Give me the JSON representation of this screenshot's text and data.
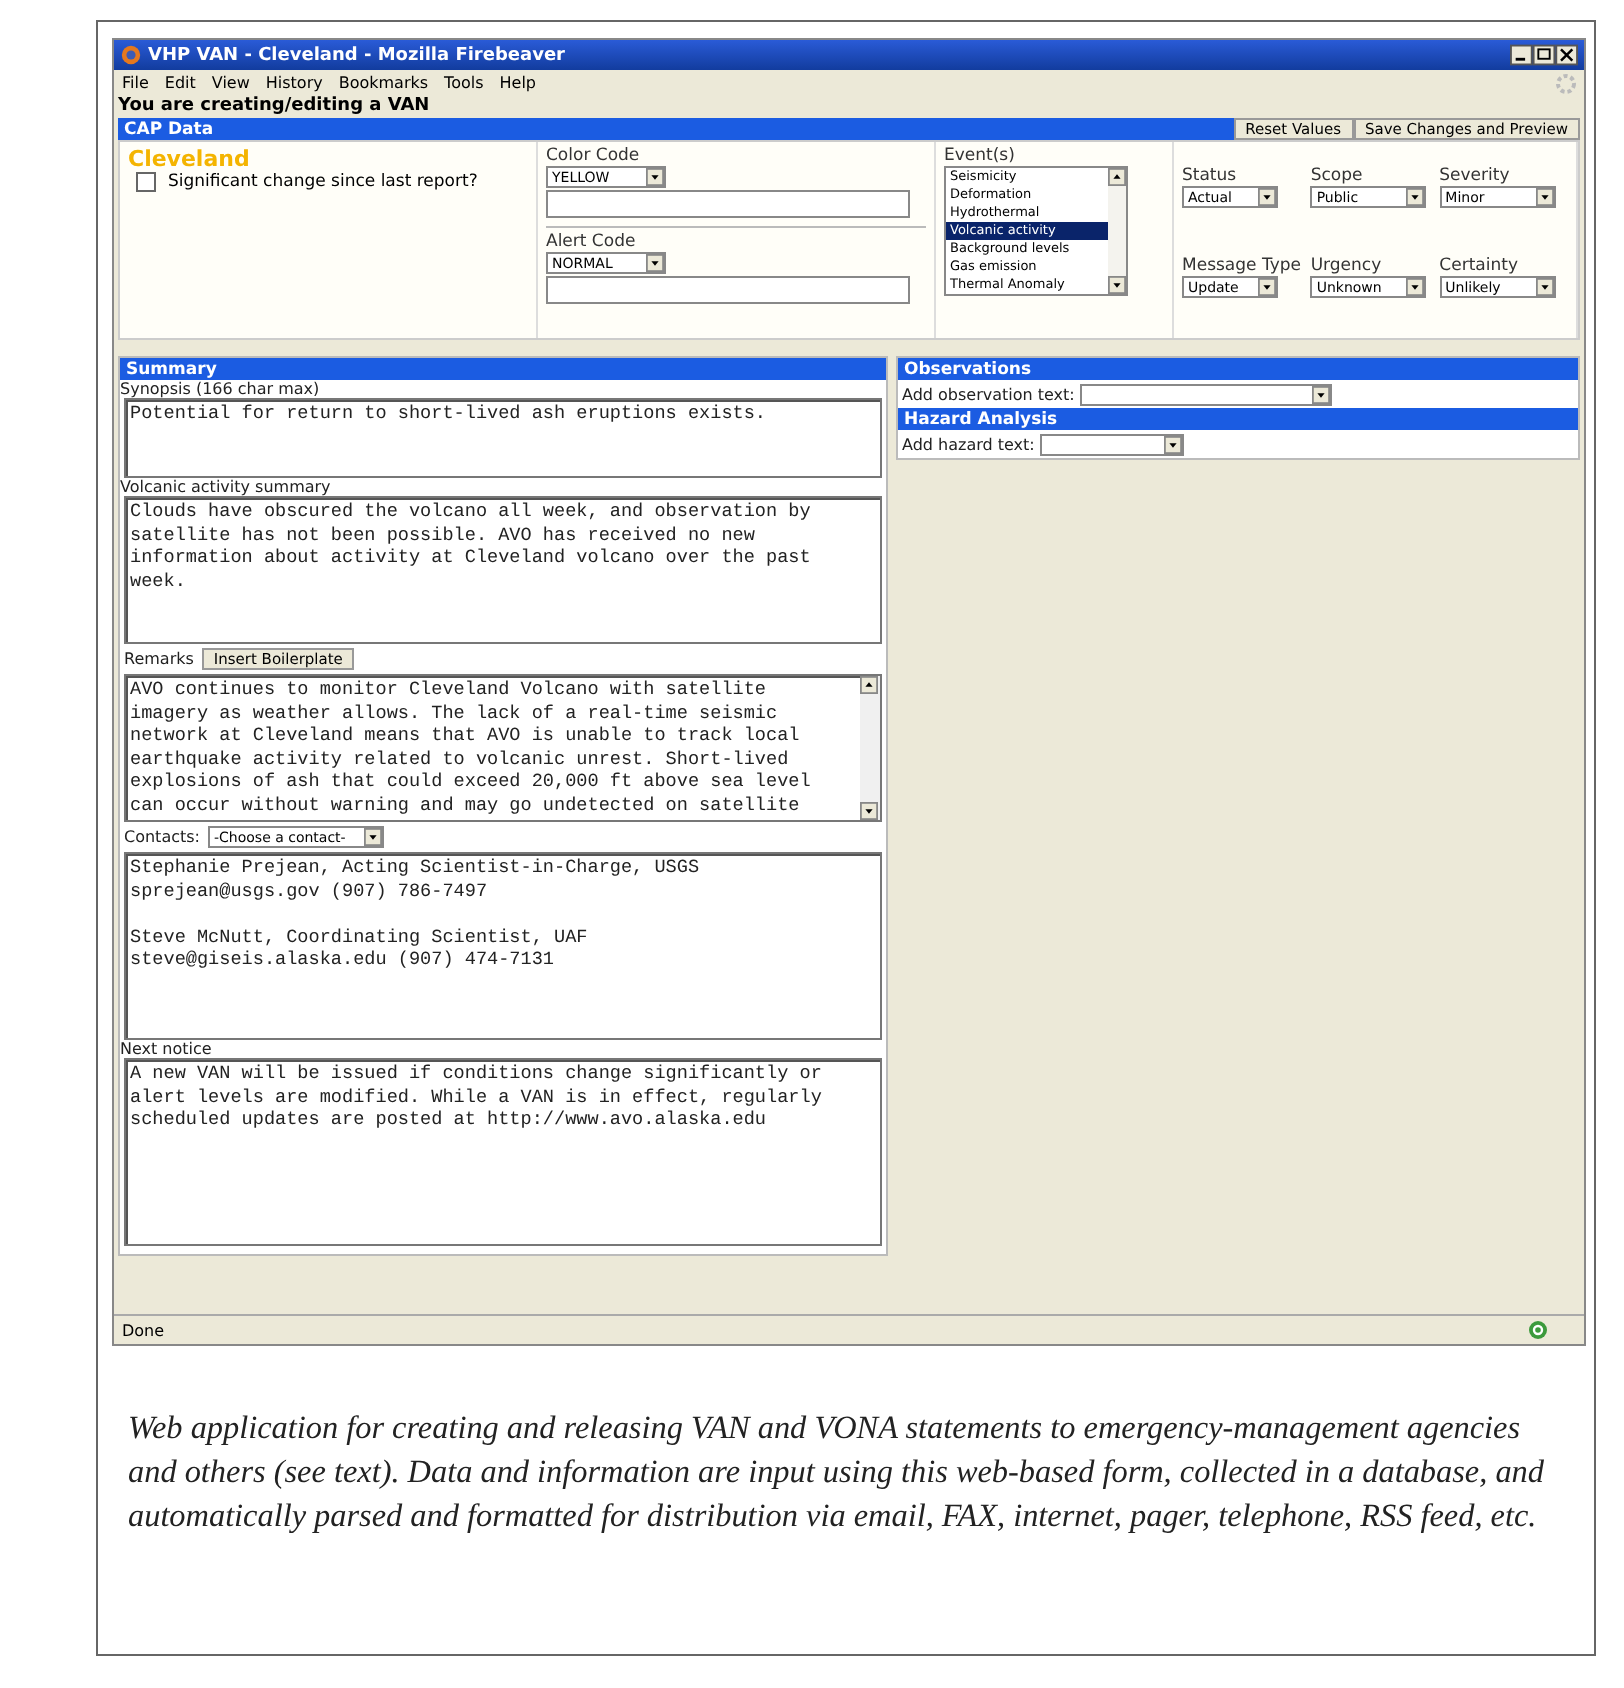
{
  "window": {
    "title": "VHP VAN - Cleveland - Mozilla Firebeaver"
  },
  "menu": [
    "File",
    "Edit",
    "View",
    "History",
    "Bookmarks",
    "Tools",
    "Help"
  ],
  "page_heading": "You are creating/editing a VAN",
  "cap_data": {
    "title": "CAP Data",
    "buttons": [
      "Reset Values",
      "Save Changes and Preview"
    ],
    "volcano": "Cleveland",
    "significant_change": {
      "label": "Significant change since last report?",
      "checked": false
    },
    "color_code": {
      "label": "Color Code",
      "value": "YELLOW"
    },
    "alert_code": {
      "label": "Alert Code",
      "value": "NORMAL"
    },
    "events": {
      "label": "Event(s)",
      "items": [
        {
          "label": "Seismicity",
          "selected": false
        },
        {
          "label": "Deformation",
          "selected": false
        },
        {
          "label": "Hydrothermal",
          "selected": false
        },
        {
          "label": "Volcanic activity",
          "selected": true
        },
        {
          "label": "Background levels",
          "selected": false
        },
        {
          "label": "Gas emission",
          "selected": false
        },
        {
          "label": "Thermal Anomaly",
          "selected": false
        }
      ]
    },
    "selects": [
      {
        "label": "Status",
        "value": "Actual"
      },
      {
        "label": "Scope",
        "value": "Public"
      },
      {
        "label": "Severity",
        "value": "Minor"
      },
      {
        "label": "Message Type",
        "value": "Update"
      },
      {
        "label": "Urgency",
        "value": "Unknown"
      },
      {
        "label": "Certainty",
        "value": "Unlikely"
      }
    ]
  },
  "summary": {
    "title": "Summary",
    "synopsis": {
      "label": "Synopsis (166 char max)",
      "lines": [
        "Potential for return to short-lived ash eruptions exists."
      ]
    },
    "activity": {
      "label": "Volcanic activity summary",
      "lines": [
        "Clouds have obscured the volcano all week, and observation by",
        "satellite has not been possible. AVO has received no new",
        "information about activity at Cleveland volcano over the past",
        "week."
      ]
    },
    "remarks": {
      "label": "Remarks",
      "button": "Insert Boilerplate",
      "lines": [
        "AVO continues to monitor Cleveland Volcano with satellite",
        "imagery as weather allows. The lack of a real-time seismic",
        "network at Cleveland means that AVO is unable to track local",
        "earthquake activity related to volcanic unrest. Short-lived",
        "explosions of ash that could exceed 20,000 ft above sea level",
        "can occur without warning and may go undetected on satellite"
      ]
    },
    "contacts": {
      "label": "Contacts:",
      "select": "-Choose a contact-",
      "entries": [
        [
          "Stephanie Prejean, Acting Scientist-in-Charge, USGS",
          "sprejean@usgs.gov (907) 786-7497"
        ],
        [
          "Steve McNutt, Coordinating Scientist, UAF",
          "steve@giseis.alaska.edu (907) 474-7131"
        ]
      ]
    },
    "next_notice": {
      "label": "Next notice",
      "lines": [
        "A new VAN will be issued if conditions change significantly or",
        "alert levels are modified. While a VAN is in effect, regularly",
        "scheduled updates are posted at http://www.avo.alaska.edu"
      ]
    }
  },
  "observations": {
    "title": "Observations",
    "label": "Add observation text:"
  },
  "hazard": {
    "title": "Hazard Analysis",
    "label": "Add hazard text:"
  },
  "status_bar": {
    "text": "Done"
  },
  "caption": "Web application for creating and releasing VAN and VONA statements to emergency-management agencies and others (see text). Data and information are input using this web-based form, collected in a database, and automatically parsed and formatted for distribution via email, FAX, internet, pager, telephone, RSS feed, etc."
}
